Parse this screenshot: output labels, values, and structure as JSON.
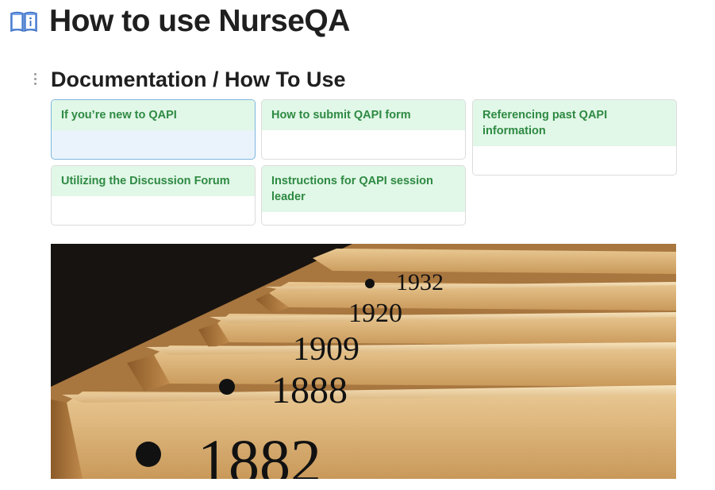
{
  "page": {
    "title": "How to use NurseQA",
    "icon": "open-book-info-icon"
  },
  "section": {
    "heading": "Documentation / How To Use",
    "drag_icon": "drag-handle-icon"
  },
  "cards": [
    {
      "label": "If you’re new to QAPI",
      "selected": true
    },
    {
      "label": "How to submit QAPI form",
      "selected": false
    },
    {
      "label": "Referencing past QAPI information",
      "selected": false
    },
    {
      "label": "Utilizing the Discussion Forum",
      "selected": false
    },
    {
      "label": "Instructions for QAPI session leader",
      "selected": false
    }
  ],
  "image": {
    "description_labels": [
      "1932",
      "1920",
      "1909",
      "1888",
      "1882"
    ]
  },
  "colors": {
    "card_header_bg": "#e1f7e7",
    "card_header_text": "#2e8a43",
    "selected_border": "#7eb6df",
    "selected_bg": "#eaf3fb"
  }
}
